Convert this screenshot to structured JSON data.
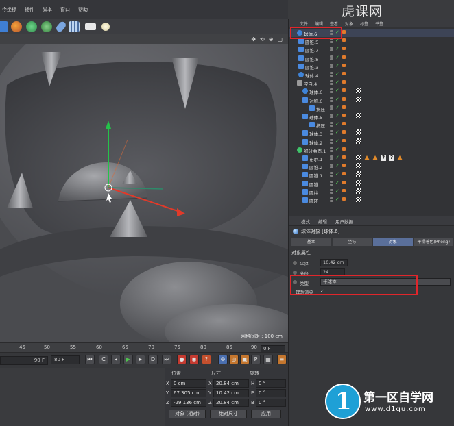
{
  "menubar": {
    "items": [
      "今坐標",
      "插件",
      "脚本",
      "窗口",
      "帮助"
    ]
  },
  "toolbar": {
    "icons": [
      "cube-icon",
      "brush-icon",
      "gear-deform-icon",
      "sphere-gear-icon",
      "capsule-icon",
      "floor-icon",
      "camera-icon",
      "light-icon"
    ]
  },
  "viewport": {
    "grid_label": "网格间距 : 100 cm",
    "header_icons": [
      "move-nav-icon",
      "camera-nav-icon",
      "zoom-nav-icon",
      "fullscreen-icon"
    ]
  },
  "timeline": {
    "ticks": [
      "45",
      "50",
      "55",
      "60",
      "65",
      "70",
      "75",
      "80",
      "85",
      "90"
    ],
    "end_frame": "0 F"
  },
  "transport": {
    "current_frame": "90 F",
    "frame_value": "80 F"
  },
  "coords": {
    "headers": {
      "position": "位置",
      "size": "尺寸",
      "rotation": "旋转"
    },
    "rows": [
      {
        "axis": "X",
        "pos": "0 cm",
        "size_axis": "X",
        "size": "20.84 cm",
        "rot_axis": "H",
        "rot": "0 °"
      },
      {
        "axis": "Y",
        "pos": "67.305 cm",
        "size_axis": "Y",
        "size": "10.42 cm",
        "rot_axis": "P",
        "rot": "0 °"
      },
      {
        "axis": "Z",
        "pos": "-29.136 cm",
        "size_axis": "Z",
        "size": "20.84 cm",
        "rot_axis": "B",
        "rot": "0 °"
      }
    ],
    "mode_select": "对象 (相对)",
    "size_select": "绝对尺寸",
    "apply_label": "应用"
  },
  "object_manager": {
    "menu": [
      "文件",
      "编辑",
      "查看",
      "对象",
      "标签",
      "书签"
    ],
    "rows": [
      {
        "name": "球体.6",
        "icon": "sphere-icon",
        "selected": true
      },
      {
        "name": "圆锥.5",
        "icon": "cone-icon"
      },
      {
        "name": "圆锥.7",
        "icon": "cone-icon"
      },
      {
        "name": "圆锥.8",
        "icon": "cone-icon"
      },
      {
        "name": "圆锥.3",
        "icon": "cone-icon"
      },
      {
        "name": "球体.4",
        "icon": "sphere-icon"
      },
      {
        "name": "空白.4",
        "icon": "null-icon"
      },
      {
        "name": "球体.6",
        "icon": "sphere-icon"
      },
      {
        "name": "对称.6",
        "icon": "symmetry-icon"
      },
      {
        "name": "挤压",
        "icon": "extrude-icon"
      },
      {
        "name": "球体.5",
        "icon": "symmetry-icon"
      },
      {
        "name": "挤压",
        "icon": "extrude-icon"
      },
      {
        "name": "球体.3",
        "icon": "symmetry-icon"
      },
      {
        "name": "球体.2",
        "icon": "symmetry-icon"
      },
      {
        "name": "细分曲面.1",
        "icon": "subdivision-icon"
      },
      {
        "name": "布尔.1",
        "icon": "boolean-icon"
      },
      {
        "name": "圆锥.2",
        "icon": "cone-icon"
      },
      {
        "name": "圆锥.1",
        "icon": "cone-icon"
      },
      {
        "name": "圆锥",
        "icon": "cone-icon"
      },
      {
        "name": "圆柱",
        "icon": "cylinder-icon"
      },
      {
        "name": "圆环",
        "icon": "torus-icon"
      }
    ]
  },
  "attribute_manager": {
    "menu": [
      "模式",
      "编辑",
      "用户数据"
    ],
    "title": "球体对象 [球体.6]",
    "tabs": [
      "基本",
      "坐标",
      "对象",
      "平滑着色(Phong)"
    ],
    "active_tab": "对象",
    "section": "对象属性",
    "radius_label": "半径",
    "radius_value": "10.42 cm",
    "segments_label": "分段",
    "segments_value": "24",
    "type_label": "类型",
    "type_value": "半球体",
    "render_label": "理想渲染",
    "render_value": "✓"
  },
  "watermark": {
    "top": "虎课网",
    "brand": "第一区自学网",
    "url": "www.d1qu.com",
    "logo": "1"
  },
  "colors": {
    "highlight": "#e0262b",
    "active_tab": "#5a6f9a",
    "check": "#55c455",
    "logo": "#1ea0d6"
  }
}
